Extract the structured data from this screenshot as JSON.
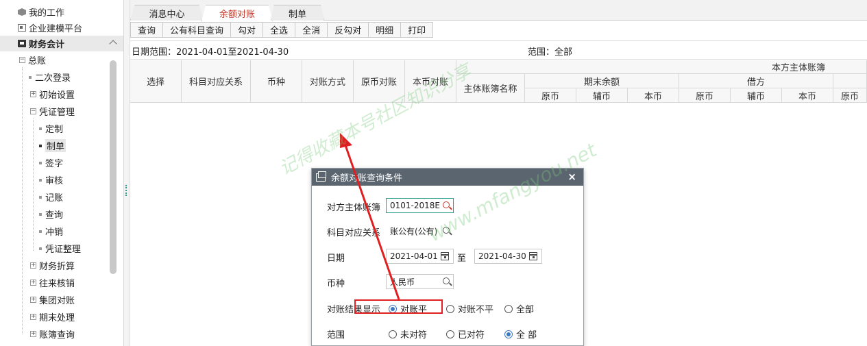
{
  "sidebar": {
    "items": [
      {
        "label": "我的工作"
      },
      {
        "label": "企业建模平台"
      },
      {
        "label": "财务会计"
      },
      {
        "label": "总账"
      },
      {
        "label": "二次登录"
      },
      {
        "label": "初始设置"
      },
      {
        "label": "凭证管理"
      },
      {
        "label": "定制"
      },
      {
        "label": "制单"
      },
      {
        "label": "签字"
      },
      {
        "label": "审核"
      },
      {
        "label": "记账"
      },
      {
        "label": "查询"
      },
      {
        "label": "冲销"
      },
      {
        "label": "凭证整理"
      },
      {
        "label": "财务折算"
      },
      {
        "label": "往来核销"
      },
      {
        "label": "集团对账"
      },
      {
        "label": "期末处理"
      },
      {
        "label": "账簿查询"
      }
    ]
  },
  "tabs": [
    {
      "label": "消息中心"
    },
    {
      "label": "余额对账"
    },
    {
      "label": "制单"
    }
  ],
  "toolbar": [
    "查询",
    "公有科目查询",
    "勾对",
    "全选",
    "全消",
    "反勾对",
    "明细",
    "打印"
  ],
  "filter": {
    "date_range": "日期范围：2021-04-01至2021-04-30",
    "scope": "范围：全部"
  },
  "grid": {
    "cols": [
      "选择",
      "科目对应关系",
      "币种",
      "对账方式",
      "原币对账",
      "本币对账"
    ],
    "group_top": "本方主体账簿",
    "book_name": "主体账簿名称",
    "period_end": "期末余额",
    "debit": "借方",
    "sub": [
      "原币",
      "辅币",
      "本币",
      "原币",
      "辅币",
      "本币",
      "原币"
    ]
  },
  "dialog": {
    "title": "余额对账查询条件",
    "fields": {
      "counter_book_label": "对方主体账簿",
      "counter_book_value": "0101-2018E",
      "subject_rel_label": "科目对应关系",
      "subject_rel_value": "账公有(公有)",
      "date_label": "日期",
      "date_from": "2021-04-01",
      "date_to_sep": "至",
      "date_to": "2021-04-30",
      "currency_label": "币种",
      "currency_value": "人民币",
      "result_label": "对账结果显示",
      "result_options": [
        "对账平",
        "对账不平",
        "全部"
      ],
      "result_selected": 0,
      "scope_label": "范围",
      "scope_options": [
        "未对符",
        "已对符",
        "全 部"
      ],
      "scope_selected": 2
    }
  },
  "watermark": {
    "line1": "记得收藏本号社区知识分享",
    "line2": "www.mfangyou.net"
  },
  "colors": {
    "accent_red": "#c0392b",
    "dialog_title": "#5b6570",
    "radio_on": "#3a78c3"
  }
}
